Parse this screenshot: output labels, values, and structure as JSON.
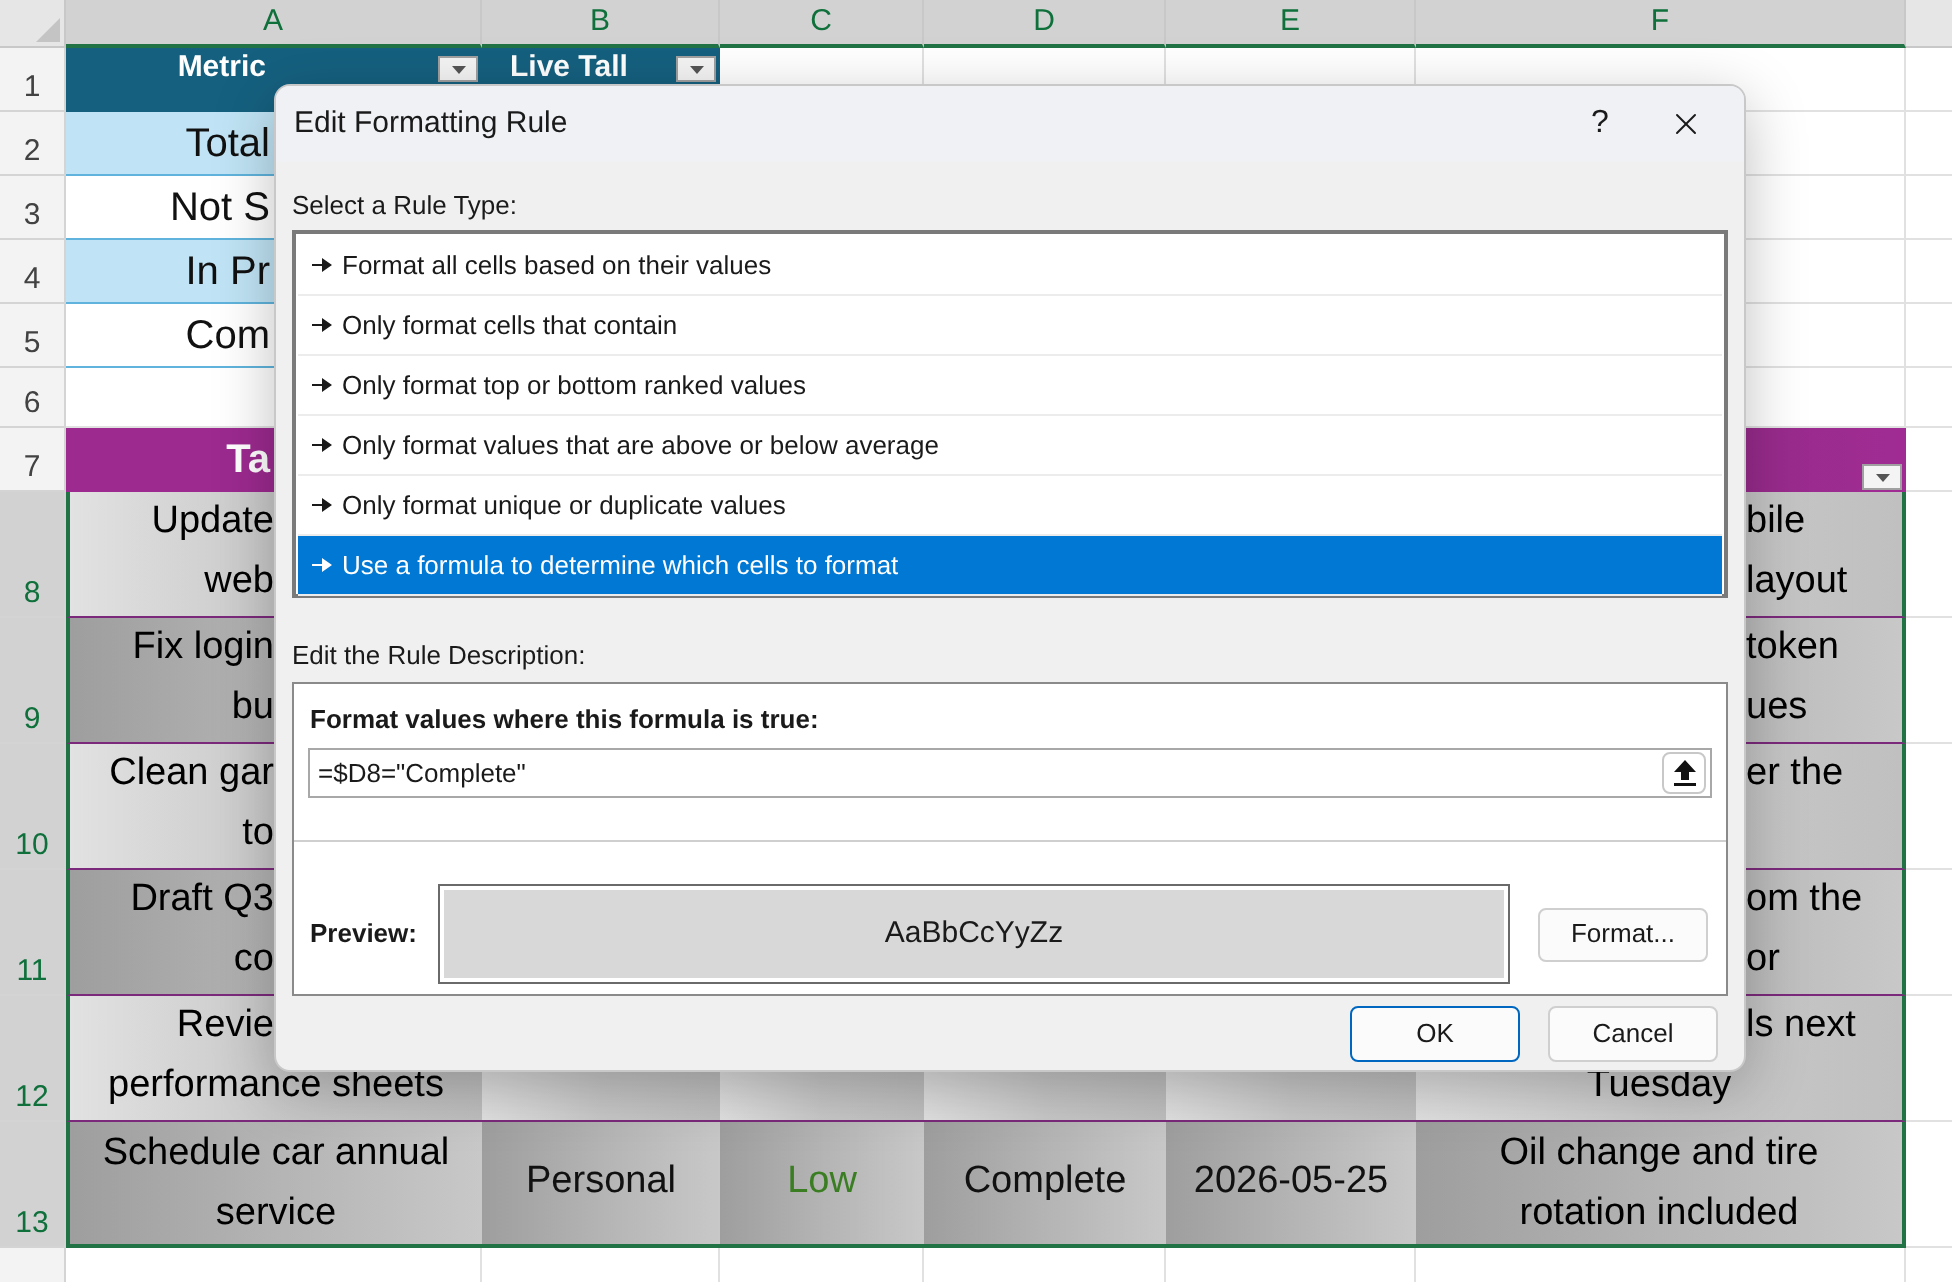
{
  "sheet": {
    "column_headers": [
      {
        "label": "A",
        "selected": true
      },
      {
        "label": "B",
        "selected": true
      },
      {
        "label": "C",
        "selected": true
      },
      {
        "label": "D",
        "selected": true
      },
      {
        "label": "E",
        "selected": true
      },
      {
        "label": "F",
        "selected": true
      }
    ],
    "row_numbers": [
      {
        "label": "1",
        "selected": false
      },
      {
        "label": "2",
        "selected": false
      },
      {
        "label": "3",
        "selected": false
      },
      {
        "label": "4",
        "selected": false
      },
      {
        "label": "5",
        "selected": false
      },
      {
        "label": "6",
        "selected": false
      },
      {
        "label": "7",
        "selected": false
      },
      {
        "label": "8",
        "selected": true
      },
      {
        "label": "9",
        "selected": true
      },
      {
        "label": "10",
        "selected": true
      },
      {
        "label": "11",
        "selected": true
      },
      {
        "label": "12",
        "selected": true
      },
      {
        "label": "13",
        "selected": true
      }
    ],
    "summary_header": [
      "Metric",
      "Live Tall"
    ],
    "summary_rows": [
      "Total",
      "Not S",
      "In Pr",
      "Com"
    ],
    "tasks_header": "Ta",
    "task_rows": [
      {
        "kind": "behind_dialog",
        "column_a": [
          "Update",
          "web"
        ],
        "column_f": [
          "bile",
          "layout"
        ]
      },
      {
        "kind": "behind_dialog",
        "column_a": [
          "Fix login",
          "bu"
        ],
        "column_f": [
          "token",
          "ues"
        ]
      },
      {
        "kind": "behind_dialog",
        "column_a": [
          "Clean gar",
          "to"
        ],
        "column_f": [
          "er the"
        ]
      },
      {
        "kind": "behind_dialog",
        "column_a": [
          "Draft Q3",
          "co"
        ],
        "column_f": [
          "om the",
          "or"
        ]
      },
      {
        "kind": "lower_line_visible",
        "column_a": [
          "Revie",
          "performance sheets"
        ],
        "column_f": [
          "ls next",
          "Tuesday"
        ]
      },
      {
        "kind": "visible",
        "column_a": [
          "Schedule car annual",
          "service"
        ],
        "column_b": "Personal",
        "column_c": "Low",
        "column_d": "Complete",
        "column_e": "2026-05-25",
        "column_f": [
          "Oil change and tire",
          "rotation included"
        ]
      }
    ]
  },
  "dialog": {
    "title": "Edit Formatting Rule",
    "help": "?",
    "rule_type_label": "Select a Rule Type:",
    "rule_types": [
      {
        "label": "Format all cells based on their values",
        "selected": false
      },
      {
        "label": "Only format cells that contain",
        "selected": false
      },
      {
        "label": "Only format top or bottom ranked values",
        "selected": false
      },
      {
        "label": "Only format values that are above or below average",
        "selected": false
      },
      {
        "label": "Only format unique or duplicate values",
        "selected": false
      },
      {
        "label": "Use a formula to determine which cells to format",
        "selected": true
      }
    ],
    "description_label": "Edit the Rule Description:",
    "formula_label": "Format values where this formula is true:",
    "formula": "=$D8=\"Complete\"",
    "preview_label": "Preview:",
    "preview_text": "AaBbCcYyZz",
    "format_button": "Format...",
    "buttons": [
      {
        "label": "OK",
        "default": true
      },
      {
        "label": "Cancel",
        "default": false
      }
    ]
  }
}
